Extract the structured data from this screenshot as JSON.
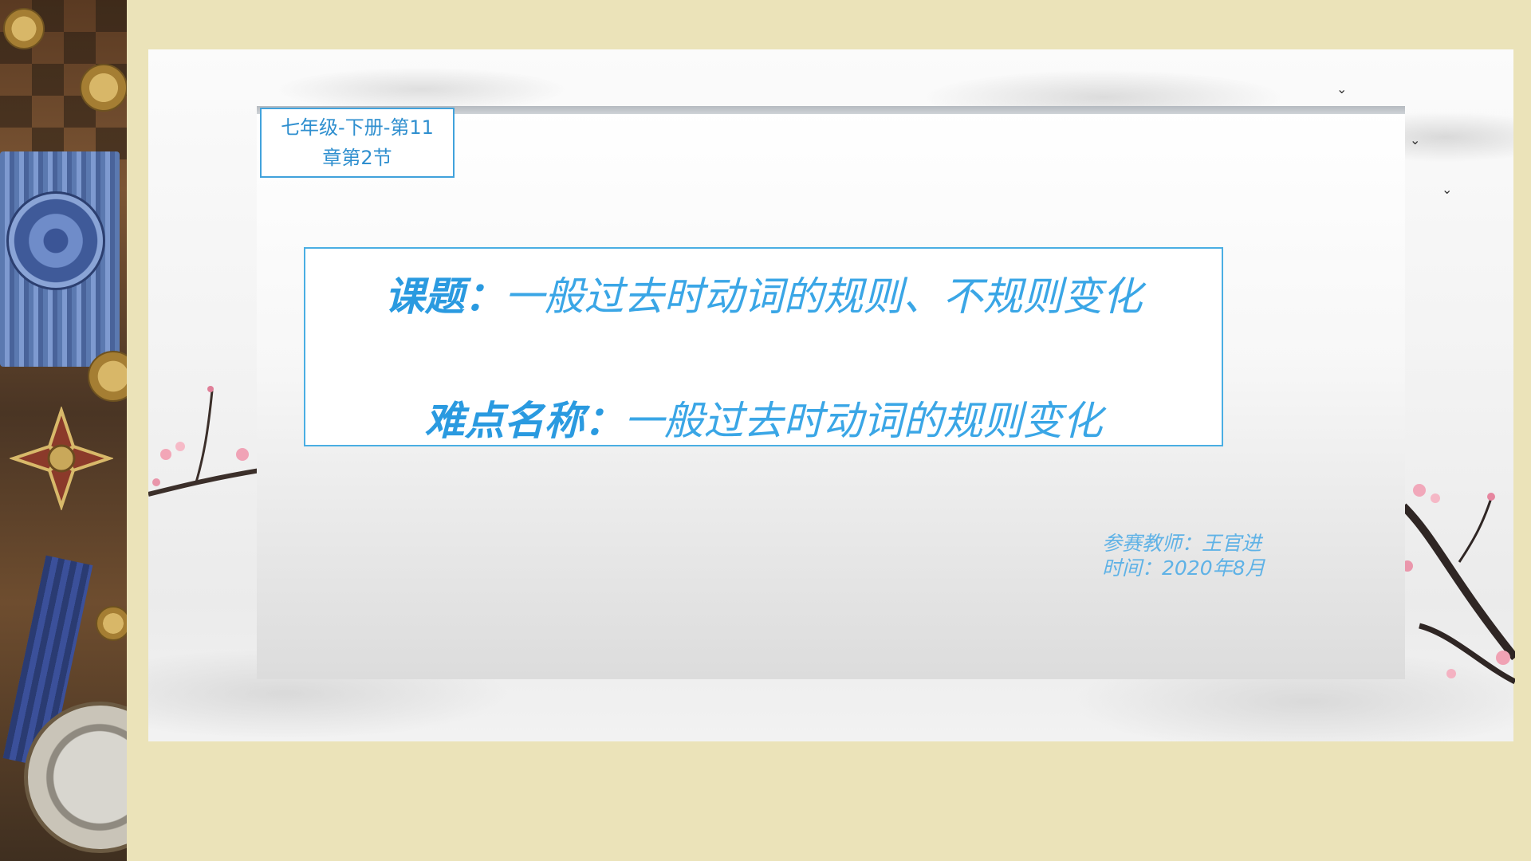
{
  "slide": {
    "chapter_line1": "七年级-下册-第11",
    "chapter_line2": "章第2节",
    "topic_label": "课题：",
    "topic_text": "一般过去时动词的规则、不规则变化",
    "difficulty_label": "难点名称：",
    "difficulty_text": "一般过去时动词的规则变化",
    "teacher_line": "参赛教师：王官进",
    "time_line": "时间：2020年8月"
  },
  "colors": {
    "background": "#ebe3b9",
    "accent_blue": "#3aa6e6",
    "border_blue": "#4aaee3"
  },
  "icons": [
    "bird-icon",
    "plum-branch-icon",
    "medal-icon",
    "compass-icon"
  ]
}
